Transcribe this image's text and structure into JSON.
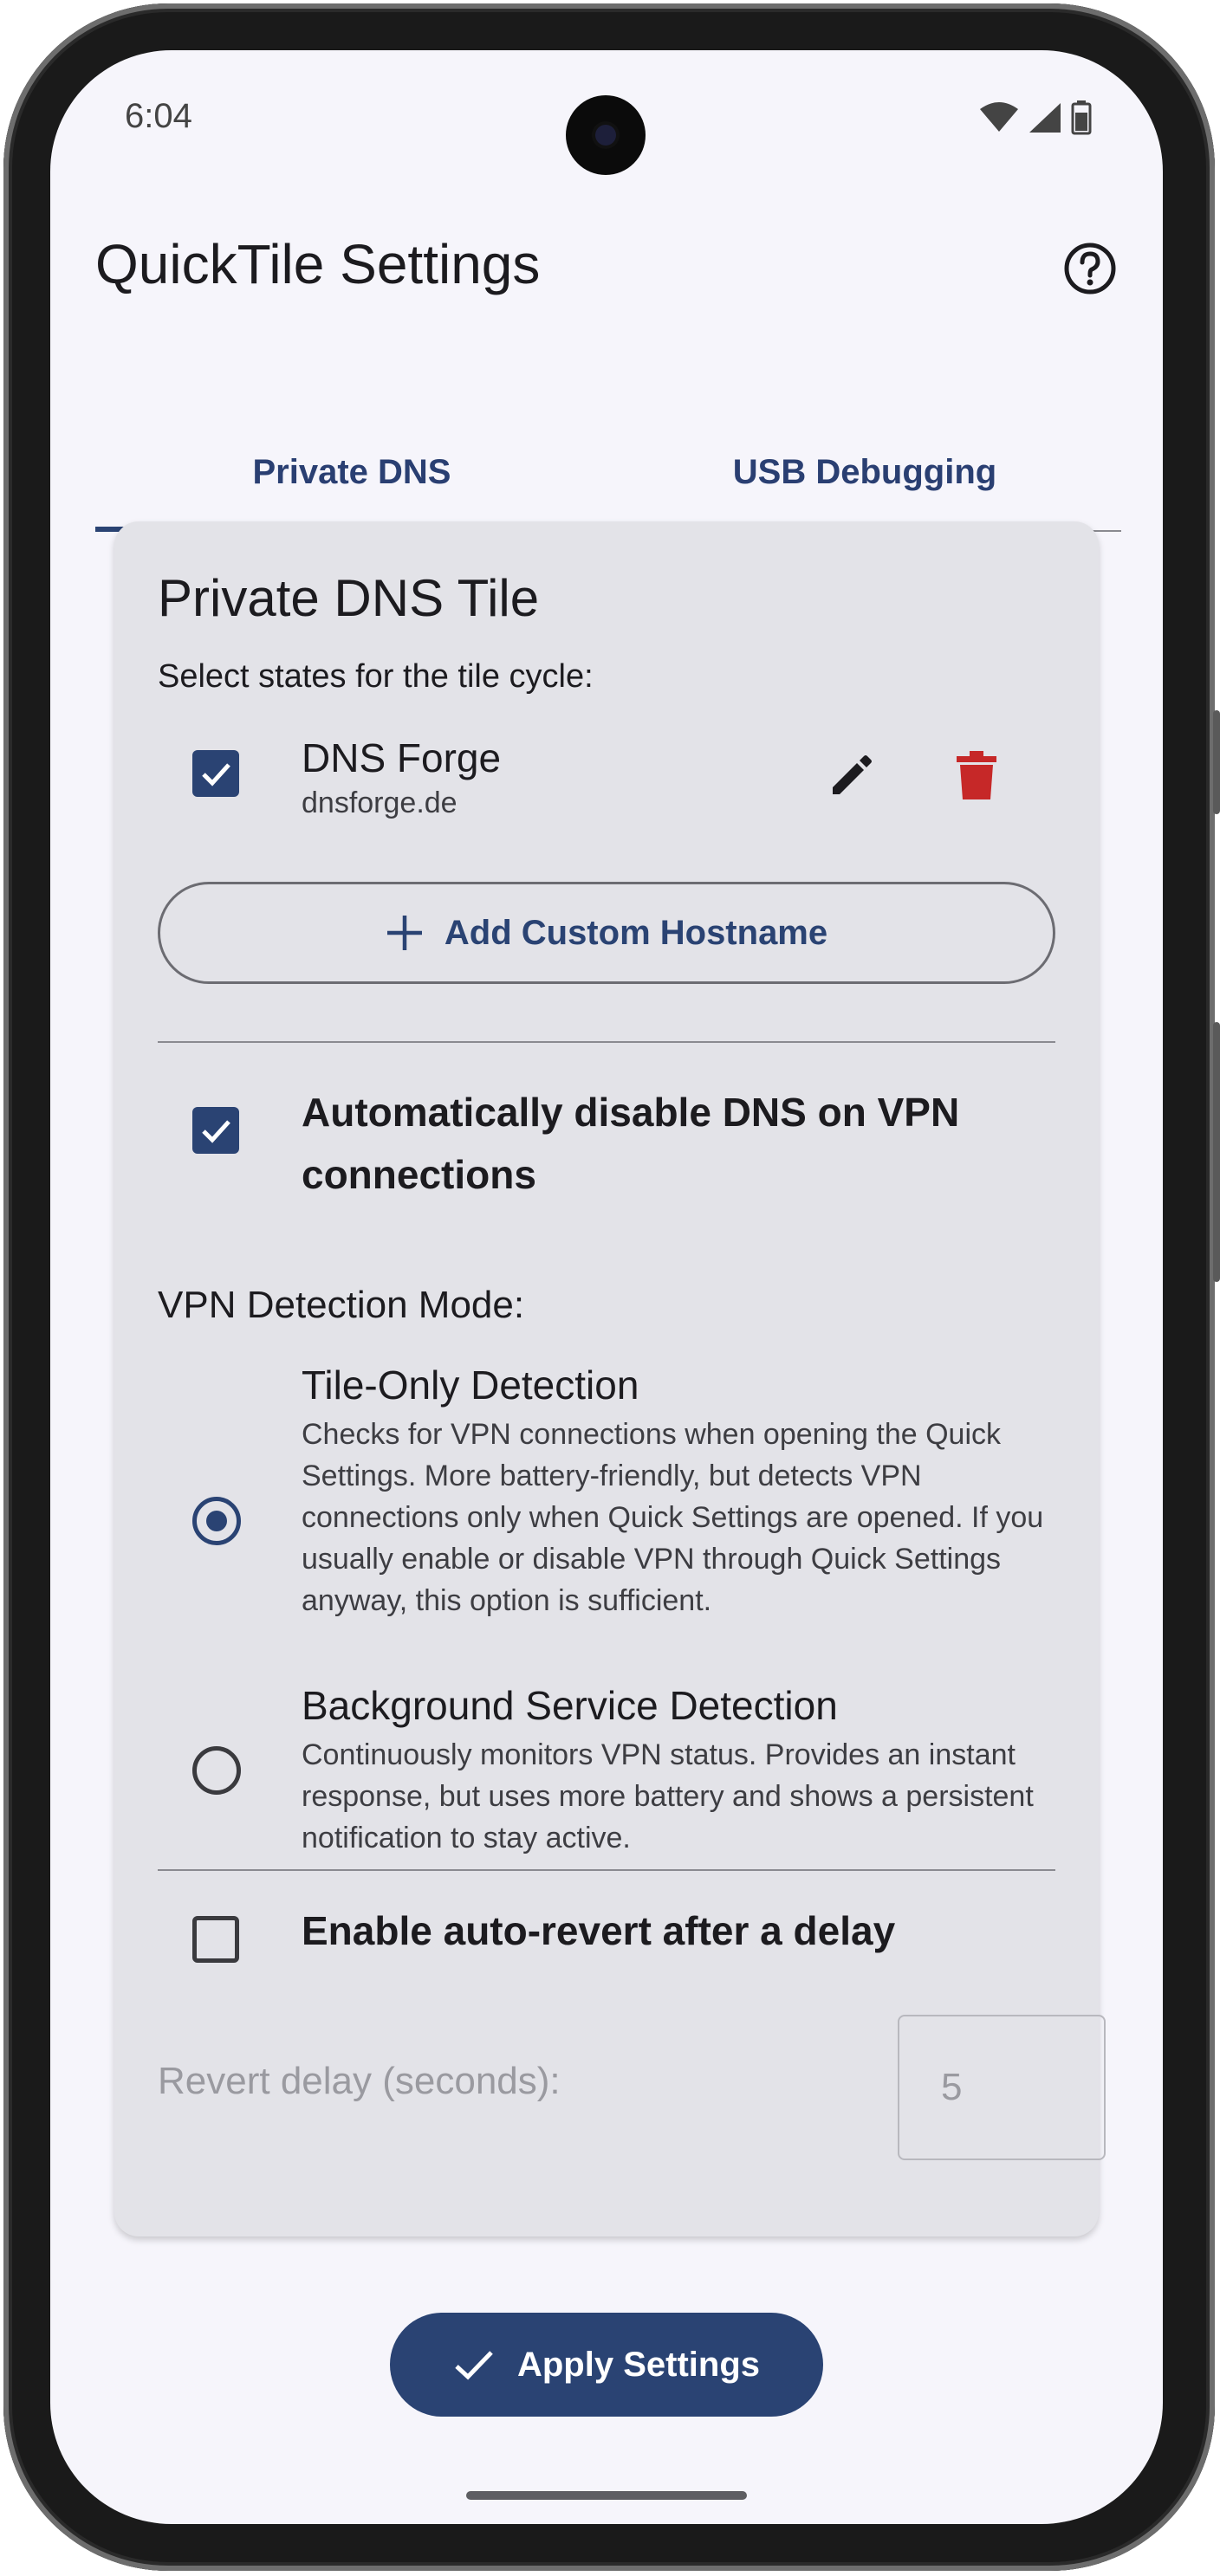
{
  "status_bar": {
    "time": "6:04"
  },
  "app_bar": {
    "title": "QuickTile Settings",
    "help_icon": "help-circle-icon"
  },
  "tabs": [
    {
      "label": "Private DNS",
      "active": true
    },
    {
      "label": "USB Debugging",
      "active": false
    }
  ],
  "card": {
    "title": "Private DNS Tile",
    "subtitle": "Select states for the tile cycle:",
    "dns_entries": [
      {
        "name": "DNS Forge",
        "hostname": "dnsforge.de",
        "checked": true
      }
    ],
    "add_button_label": "Add Custom Hostname",
    "auto_disable": {
      "label": "Automatically disable DNS on VPN connections",
      "checked": true
    },
    "vpn_mode_label": "VPN Detection Mode:",
    "vpn_options": [
      {
        "title": "Tile-Only Detection",
        "description": "Checks for VPN connections when opening the Quick Settings. More battery-friendly, but detects VPN connections only when Quick Settings are opened. If you usually enable or disable VPN through Quick Settings anyway, this option is sufficient.",
        "selected": true
      },
      {
        "title": "Background Service Detection",
        "description": "Continuously monitors VPN status. Provides an instant response, but uses more battery and shows a persistent notification to stay active.",
        "selected": false
      }
    ],
    "auto_revert": {
      "label": "Enable auto-revert after a delay",
      "checked": false
    },
    "revert_delay": {
      "label": "Revert delay (seconds):",
      "value": "5"
    }
  },
  "apply_button_label": "Apply Settings",
  "colors": {
    "primary": "#2a4373",
    "delete": "#c62828",
    "card_bg": "#e3e3e8",
    "screen_bg": "#f6f5fb"
  }
}
